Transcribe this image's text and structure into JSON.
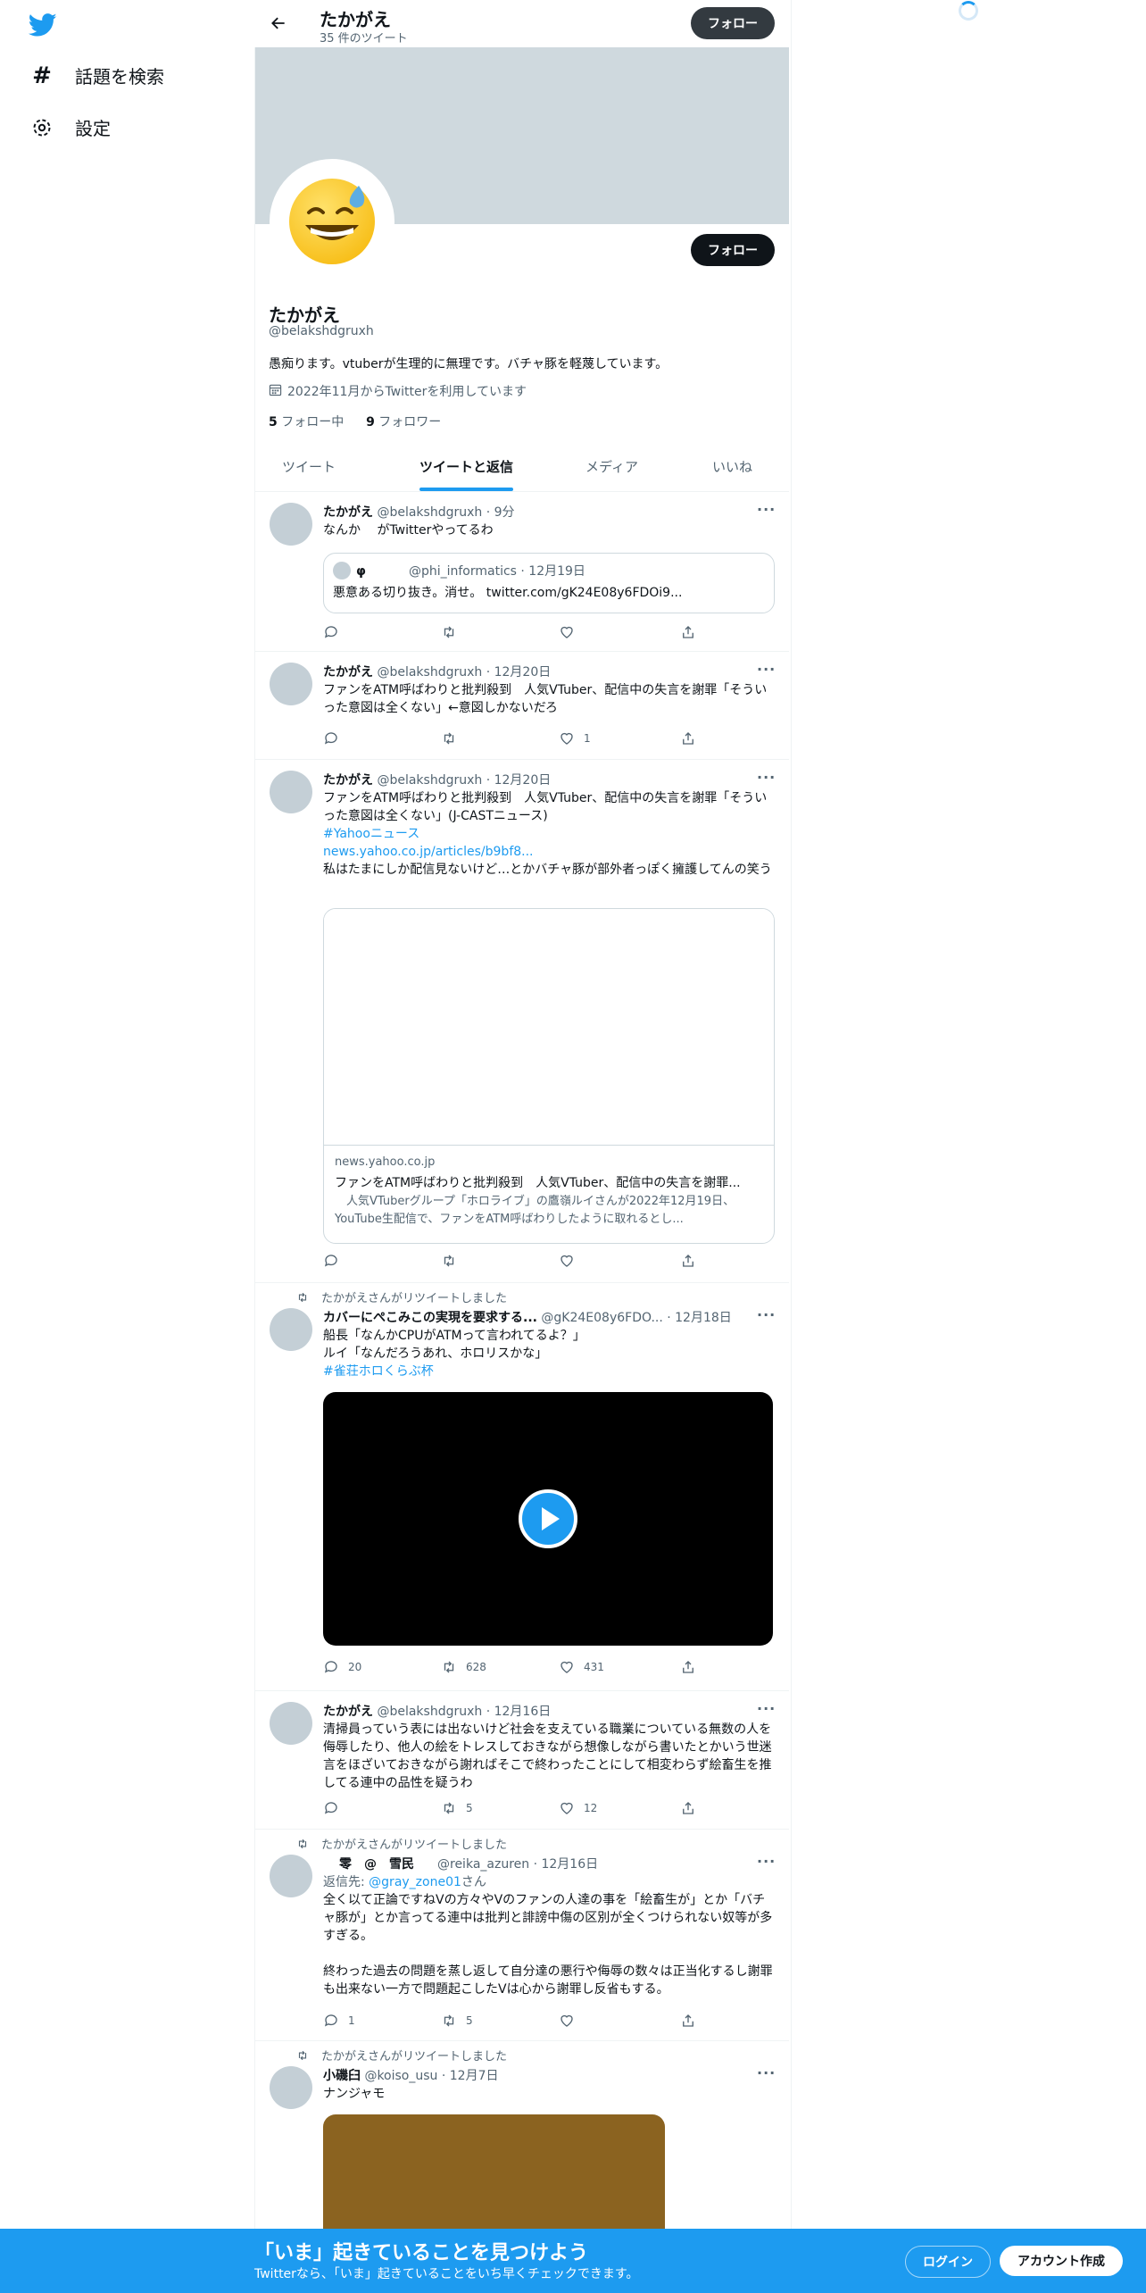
{
  "nav": {
    "explore_label": "話題を検索",
    "settings_label": "設定"
  },
  "header": {
    "name": "たかがえ",
    "tweet_count": "35 件のツイート",
    "follow_label": "フォロー"
  },
  "profile": {
    "name": "たかがえ",
    "handle": "@belakshdgruxh",
    "bio": "愚痴ります。vtuberが生理的に無理です。バチャ豚を軽蔑しています。",
    "joined": "2022年11月からTwitterを利用しています",
    "following_count": "5",
    "following_label": " フォロー中",
    "followers_count": "9",
    "followers_label": " フォロワー",
    "follow_label": "フォロー"
  },
  "tabs": [
    "ツイート",
    "ツイートと返信",
    "メディア",
    "いいね"
  ],
  "tweets": [
    {
      "name": "たかがえ",
      "meta": "@belakshdgruxh · 9分",
      "text": "なんか　 がTwitterやってるわ",
      "quote": {
        "name": "φ",
        "meta": "@phi_informatics · 12月19日",
        "text": "悪意ある切り抜き。消せ。 twitter.com/gK24E08y6FDOi9..."
      },
      "counts": {
        "reply": "",
        "retweet": "",
        "like": ""
      }
    },
    {
      "name": "たかがえ",
      "meta": "@belakshdgruxh · 12月20日",
      "text": "ファンをATM呼ばわりと批判殺到　人気VTuber、配信中の失言を謝罪「そういった意図は全くない」←意図しかないだろ",
      "counts": {
        "reply": "",
        "retweet": "",
        "like": "1"
      }
    },
    {
      "name": "たかがえ",
      "meta": "@belakshdgruxh · 12月20日",
      "text": "ファンをATM呼ばわりと批判殺到　人気VTuber、配信中の失言を謝罪「そういった意図は全くない」(J-CASTニュース)",
      "hashtag": "#Yahooニュース",
      "url": "news.yahoo.co.jp/articles/b9bf8...",
      "text2": "私はたまにしか配信見ないけど…とかバチャ豚が部外者っぽく擁護してんの笑う",
      "card": {
        "domain": "news.yahoo.co.jp",
        "title": "ファンをATM呼ばわりと批判殺到　人気VTuber、配信中の失言を謝罪...",
        "desc": "　人気VTuberグループ「ホロライブ」の鷹嶺ルイさんが2022年12月19日、YouTube生配信で、ファンをATM呼ばわりしたように取れるとし..."
      },
      "counts": {
        "reply": "",
        "retweet": "",
        "like": ""
      }
    },
    {
      "rt_label": "たかがえさんがリツイートしました",
      "name": "カバーにぺこみこの実現を要求する...",
      "meta": "@gK24E08y6FDO... · 12月18日",
      "lines": [
        "船長「なんかCPUがATMって言われてるよ？」",
        "ルイ「なんだろうあれ、ホロリスかな」"
      ],
      "hashtag": "#雀荘ホロくらぶ杯",
      "counts": {
        "reply": "20",
        "retweet": "628",
        "like": "431"
      }
    },
    {
      "name": "たかがえ",
      "meta": "@belakshdgruxh · 12月16日",
      "text": "清掃員っていう表には出ないけど社会を支えている職業についている無数の人を侮辱したり、他人の絵をトレスしておきながら想像しながら書いたとかいう世迷言をほざいておきながら謝ればそこで終わったことにして相変わらず絵畜生を推してる連中の品性を疑うわ",
      "counts": {
        "reply": "",
        "retweet": "5",
        "like": "12"
      }
    },
    {
      "rt_label": "たかがえさんがリツイートしました",
      "name": "零　@　雪民",
      "meta": "@reika_azuren · 12月16日",
      "reply_prefix": "返信先: ",
      "reply_to": "@gray_zone01",
      "reply_suffix": "さん",
      "text": "全く以て正論ですねVの方々やVのファンの人達の事を「絵畜生が」とか「バチャ豚が」とか言ってる連中は批判と誹謗中傷の区別が全くつけられない奴等が多すぎる。",
      "text2": "終わった過去の問題を蒸し返して自分達の悪行や侮辱の数々は正当化するし謝罪も出来ない一方で問題起こしたVは心から謝罪し反省もする。",
      "counts": {
        "reply": "1",
        "retweet": "5",
        "like": ""
      }
    },
    {
      "rt_label": "たかがえさんがリツイートしました",
      "name": "小磯臼",
      "meta": "@koiso_usu · 12月7日",
      "text": "ナンジャモ"
    }
  ],
  "bottom": {
    "title": "「いま」起きていることを見つけよう",
    "sub": "Twitterなら、「いま」起きていることをいち早くチェックできます。",
    "login_label": "ログイン",
    "signup_label": "アカウント作成"
  },
  "colors": {
    "accent": "#1d9bf0",
    "dark": "#0f1419",
    "muted": "#536471",
    "banner": "#cfd9de"
  }
}
